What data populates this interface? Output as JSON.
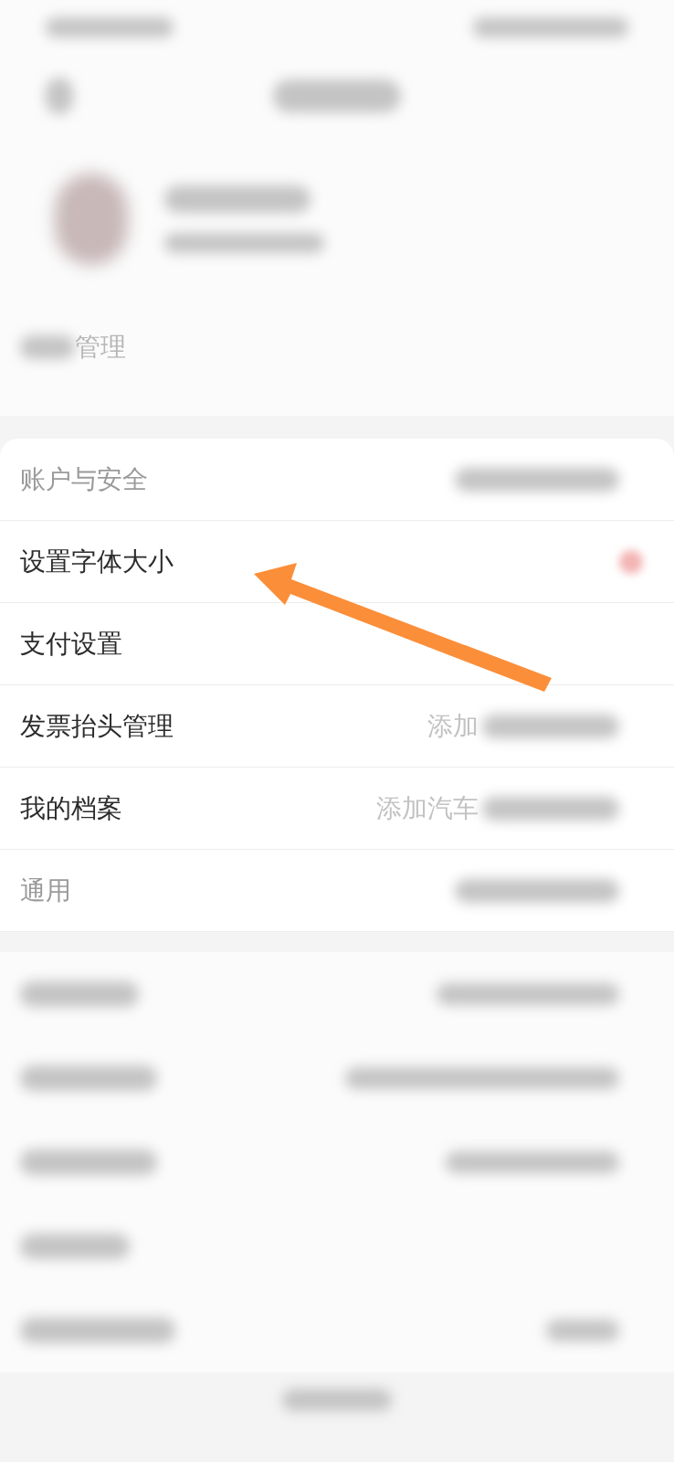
{
  "top_section": {
    "partial_label": "管理"
  },
  "menu": [
    {
      "label": "账户与安全",
      "dimmed": true
    },
    {
      "label": "设置字体大小",
      "dimmed": false
    },
    {
      "label": "支付设置",
      "dimmed": false
    },
    {
      "label": "发票抬头管理",
      "dimmed": false,
      "value": "添加"
    },
    {
      "label": "我的档案",
      "dimmed": false,
      "value": "添加汽车"
    },
    {
      "label": "通用",
      "dimmed": true
    }
  ],
  "annotation": {
    "kind": "arrow"
  }
}
